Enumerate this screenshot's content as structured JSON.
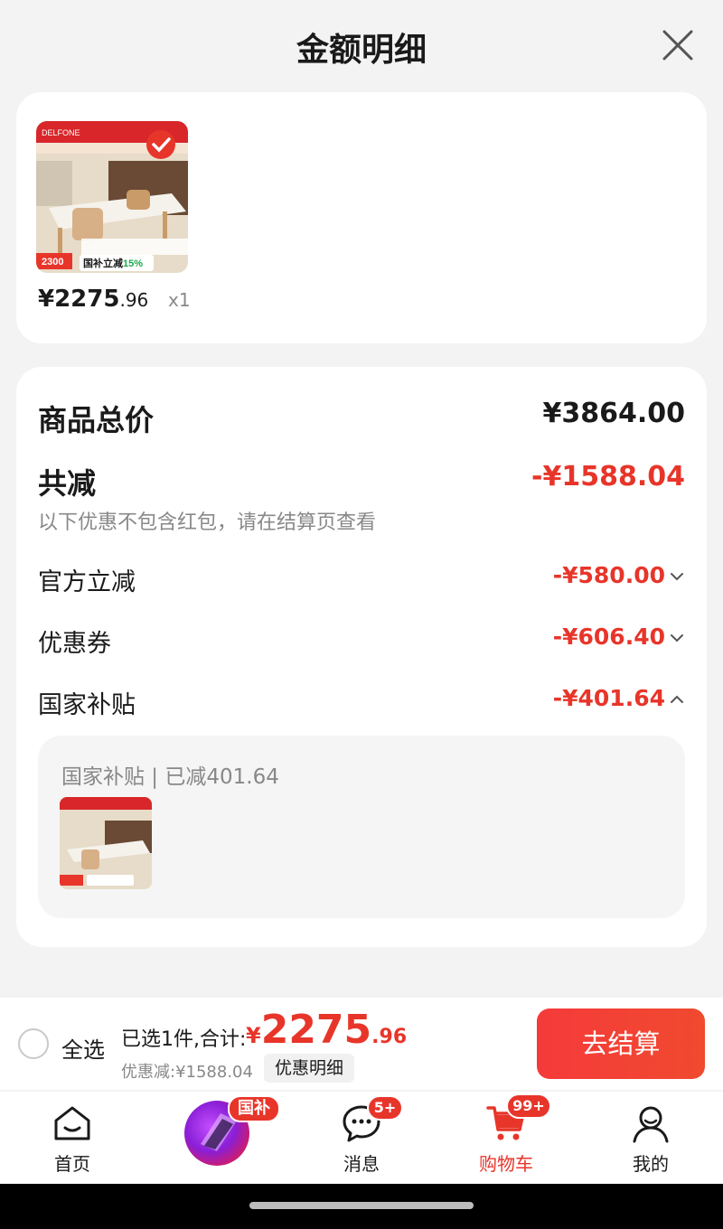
{
  "header": {
    "title": "金额明细"
  },
  "product": {
    "price_int": "¥2275",
    "price_dec": ".96",
    "quantity": "x1"
  },
  "details": {
    "total_label": "商品总价",
    "total_value": "¥3864.00",
    "reduce_label": "共减",
    "reduce_value": "-¥1588.04",
    "note": "以下优惠不包含红包，请在结算页查看",
    "items": [
      {
        "label": "官方立减",
        "value": "-¥580.00",
        "expanded": false
      },
      {
        "label": "优惠券",
        "value": "-¥606.40",
        "expanded": false
      },
      {
        "label": "国家补贴",
        "value": "-¥401.64",
        "expanded": true
      }
    ],
    "subsidy_title": "国家补贴 | 已减401.64"
  },
  "bottom_bar": {
    "select_all": "全选",
    "selected_text": "已选1件,合计:",
    "sum_yen": "¥",
    "sum_int": "2275",
    "sum_dec": ".96",
    "discount_text": "优惠减:¥1588.04",
    "detail_tag": "优惠明细",
    "checkout": "去结算"
  },
  "tabbar": {
    "home": "首页",
    "subsidy_badge": "国补",
    "messages": "消息",
    "messages_badge": "5+",
    "cart": "购物车",
    "cart_badge": "99+",
    "me": "我的"
  },
  "product_image": {
    "brand": "DELFONE",
    "promo_badge": "国补立减15%",
    "price_tag": "2300"
  },
  "colors": {
    "accent": "#e8352a",
    "background": "#f3f3f3",
    "card": "#ffffff"
  }
}
